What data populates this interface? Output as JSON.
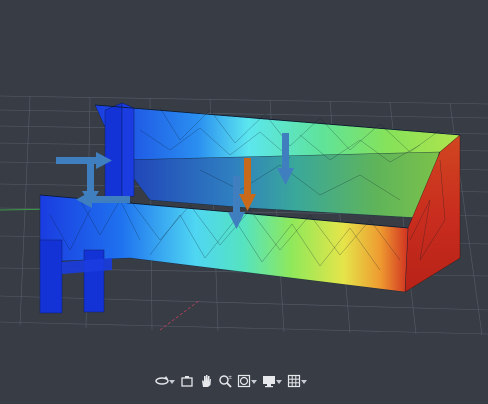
{
  "viewport": {
    "background": "#373c45",
    "grid_color": "#5c6470",
    "axis_colors": {
      "x": "#b5405a",
      "y": "#3a9a42"
    }
  },
  "model": {
    "colormap": [
      "#1a3ce0",
      "#1f86ef",
      "#55e0f0",
      "#5ee3a0",
      "#8fe85a",
      "#d8e94a",
      "#ea9a32",
      "#cf2b20"
    ],
    "arrows": [
      {
        "color": "#3f7fbf",
        "direction": "right"
      },
      {
        "color": "#3f7fbf",
        "direction": "down"
      },
      {
        "color": "#3f7fbf",
        "direction": "left"
      },
      {
        "color": "#3f7fbf",
        "direction": "down"
      },
      {
        "color": "#3f7fbf",
        "direction": "down"
      },
      {
        "color": "#c86a1a",
        "direction": "down"
      }
    ]
  },
  "toolbar": {
    "icons": [
      "rotate-icon",
      "camera-icon",
      "pan-hand-icon",
      "zoom-icon",
      "view-cube-icon",
      "display-icon",
      "grid-icon"
    ]
  }
}
